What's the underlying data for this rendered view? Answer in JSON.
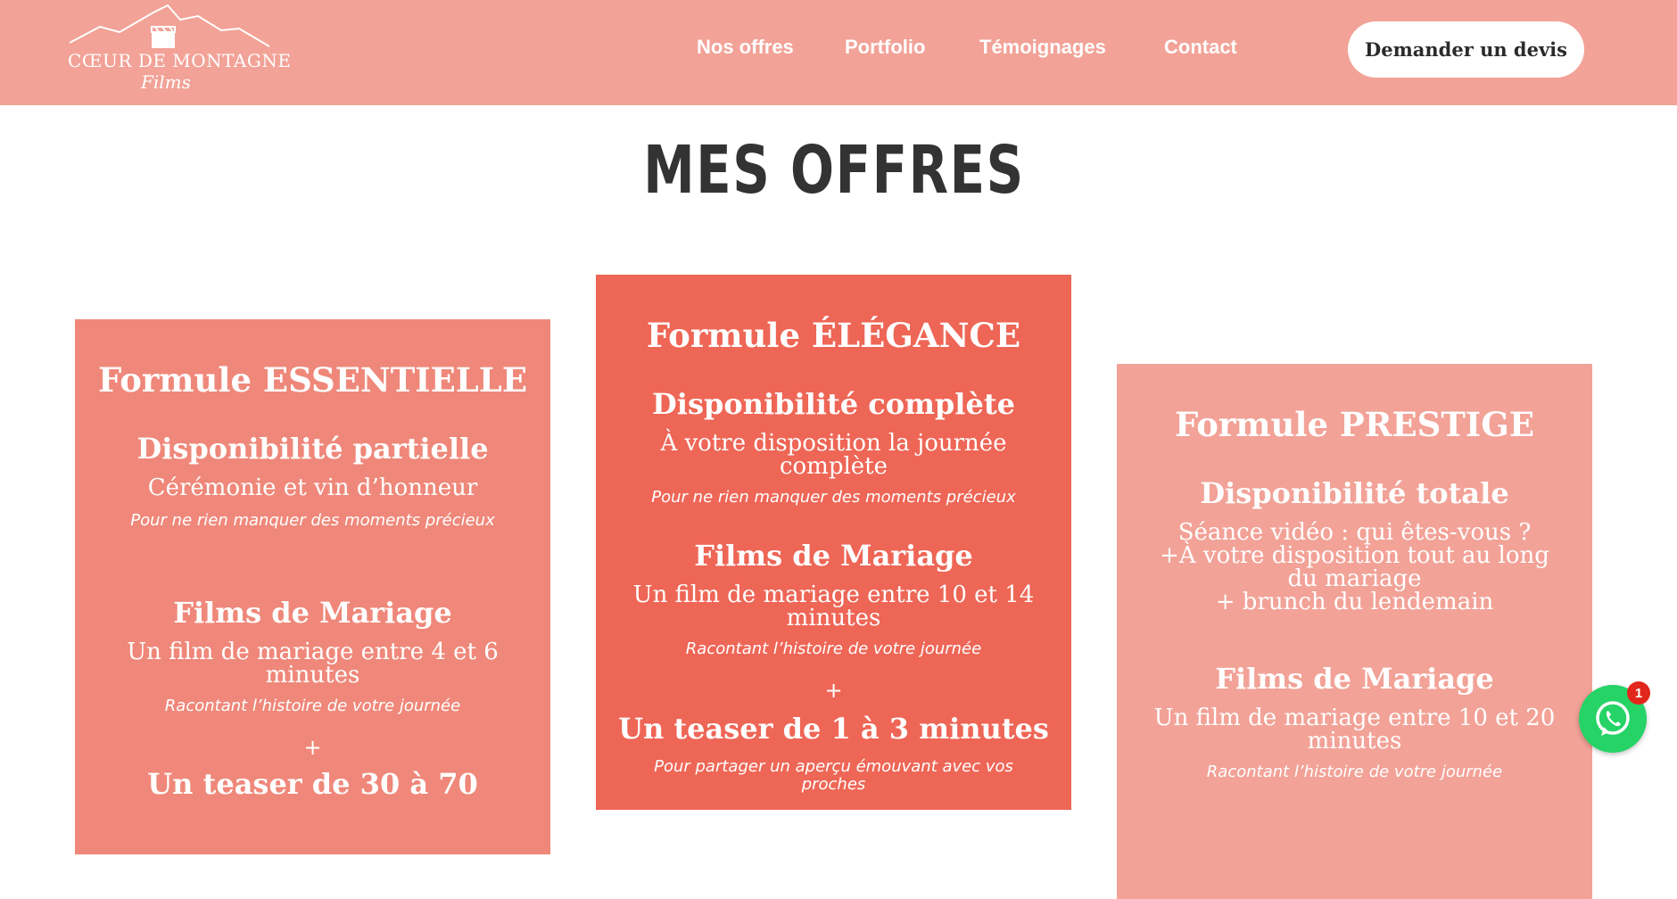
{
  "header": {
    "logo": {
      "main": "Cœur de Montagne",
      "sub": "Films"
    },
    "nav": [
      {
        "label": "Nos offres"
      },
      {
        "label": "Portfolio"
      },
      {
        "label": "Témoignages"
      },
      {
        "label": "Contact"
      }
    ],
    "cta_label": "Demander un devis"
  },
  "main": {
    "title": "MES OFFRES",
    "cards": [
      {
        "title": "Formule ESSENTIELLE",
        "availability_title": "Disponibilité partielle",
        "availability_text": "Cérémonie et vin d’honneur",
        "availability_note": "Pour ne rien manquer des moments précieux",
        "film_title": "Films de Mariage",
        "film_text": "Un film de mariage entre 4 et 6 minutes",
        "film_note": "Racontant l’histoire de votre journée",
        "plus": "+",
        "extra_title": "Un teaser de 30 à 70"
      },
      {
        "title": "Formule ÉLÉGANCE",
        "availability_title": "Disponibilité complète",
        "availability_text": "À votre disposition la journée complète",
        "availability_note": "Pour ne rien manquer des moments précieux",
        "film_title": "Films de Mariage",
        "film_text": "Un film de mariage entre 10 et 14 minutes",
        "film_note": "Racontant l’histoire de votre journée",
        "plus": "+",
        "extra_title": "Un teaser de 1 à 3 minutes",
        "extra_note": "Pour partager un aperçu émouvant avec vos proches"
      },
      {
        "title": "Formule PRESTIGE",
        "availability_title": "Disponibilité totale",
        "availability_line1": "Séance vidéo : qui êtes-vous ?",
        "availability_line2": "+À votre disposition tout au long du mariage",
        "availability_line3": "+ brunch du lendemain",
        "film_title": "Films de Mariage",
        "film_text": "Un film de mariage entre 10 et 20 minutes",
        "film_note": "Racontant l’histoire de votre journée"
      }
    ]
  },
  "whatsapp": {
    "badge": "1"
  },
  "colors": {
    "header_bg": "#f2a297",
    "card_essentielle": "#ef887a",
    "card_elegance": "#ee6656",
    "card_prestige": "#f2a297",
    "whatsapp": "#25d366",
    "badge": "#e3261b"
  }
}
